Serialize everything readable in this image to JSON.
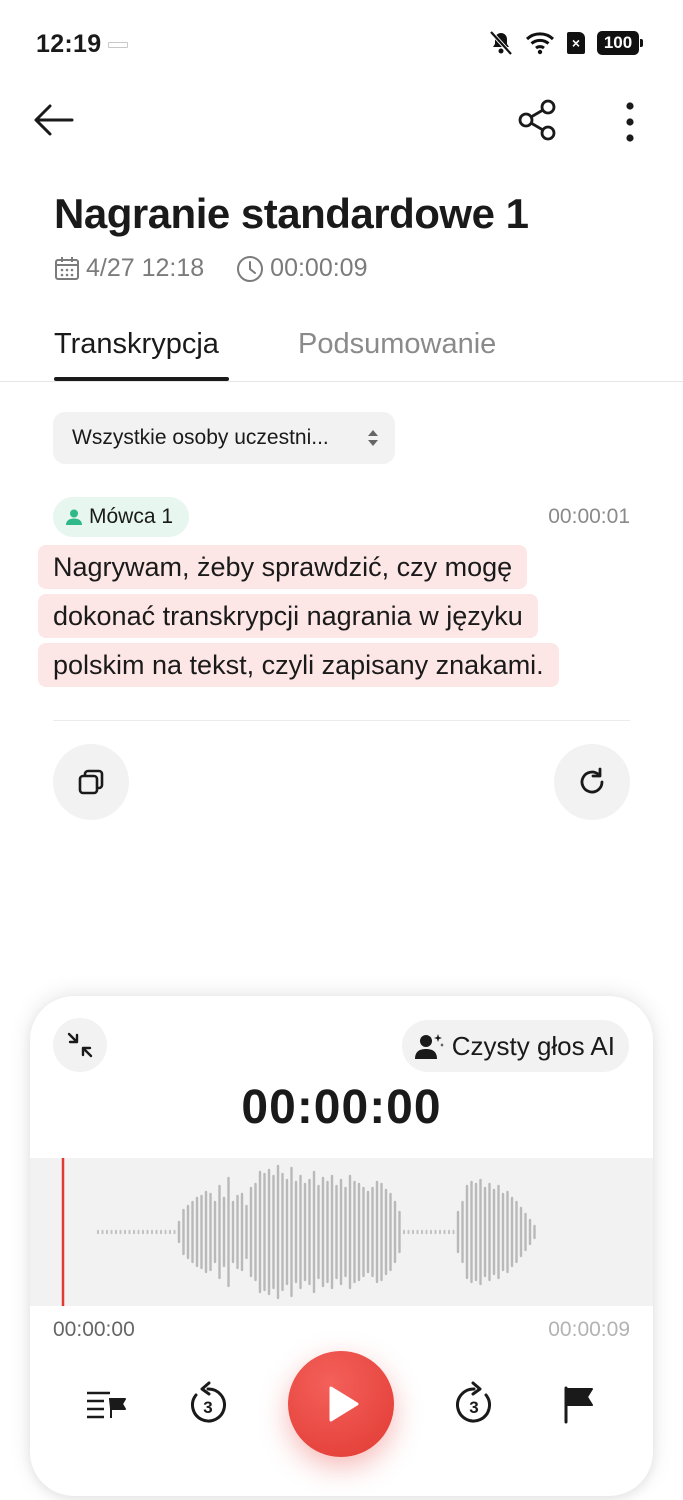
{
  "status_bar": {
    "time": "12:19",
    "battery": "100",
    "sim": "×",
    "icons": [
      "notifications-off-icon",
      "wifi-icon",
      "sim-icon",
      "battery-icon"
    ]
  },
  "top_bar": {
    "icons": [
      "back-arrow-icon",
      "share-icon",
      "more-vertical-icon"
    ]
  },
  "recording": {
    "title": "Nagranie standardowe 1",
    "date": "4/27 12:18",
    "duration": "00:00:09"
  },
  "tabs": [
    {
      "label": "Transkrypcja",
      "active": true
    },
    {
      "label": "Podsumowanie",
      "active": false
    }
  ],
  "filter": {
    "selected": "Wszystkie osoby uczestni..."
  },
  "transcript": {
    "speaker": "Mówca 1",
    "timestamp": "00:00:01",
    "lines": [
      "Nagrywam, żeby sprawdzić, czy mogę",
      "dokonać transkrypcji nagrania w języku",
      "polskim na tekst, czyli zapisany znakami."
    ],
    "highlight_color": "#fde6e6"
  },
  "actions": {
    "icons": [
      "copy-icon",
      "refresh-icon"
    ]
  },
  "player": {
    "ai_voice_label": "Czysty głos AI",
    "current_time": "00:00:00",
    "position_label": "00:00:00",
    "total_label": "00:00:09",
    "playhead_color": "#e13a33",
    "accent_color": "#e8453d",
    "controls": [
      "transcript-flags-icon",
      "rewind-3-icon",
      "play-icon",
      "forward-3-icon",
      "flag-icon"
    ]
  }
}
